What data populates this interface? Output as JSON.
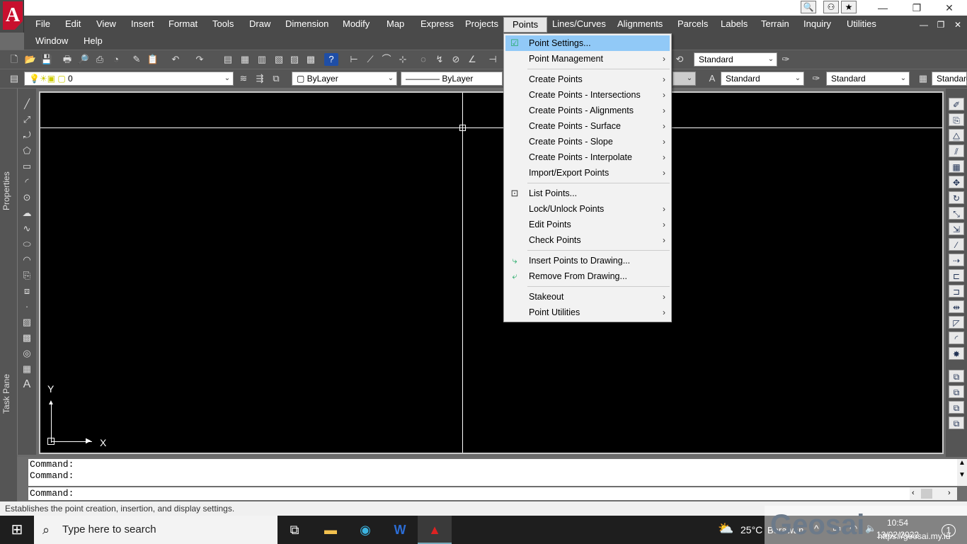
{
  "app": {
    "logo_letter": "A",
    "window_controls": [
      "—",
      "❐",
      "✕"
    ],
    "title_buttons": [
      "🔍",
      "⚇",
      "★"
    ]
  },
  "menubar": {
    "row1": [
      "File",
      "Edit",
      "View",
      "Insert",
      "Format",
      "Tools",
      "Draw",
      "Dimension",
      "Modify",
      "Map",
      "Express",
      "Projects",
      "Points",
      "Lines/Curves",
      "Alignments",
      "Parcels",
      "Labels",
      "Terrain",
      "Inquiry",
      "Utilities"
    ],
    "row2": [
      "Window",
      "Help"
    ],
    "active": "Points",
    "mdi_controls": [
      "—",
      "❐",
      "✕"
    ]
  },
  "toolbar1": {
    "style_combo": "Standard"
  },
  "toolbar2": {
    "layer_combo": "0",
    "color_combo": "ByLayer",
    "linetype_combo": "ByLayer",
    "textstyle_combo": "Standard",
    "dimstyle_combo": "Standard",
    "tablestyle_combo": "Standard"
  },
  "side_tabs": {
    "properties": "Properties",
    "task_pane": "Task Pane"
  },
  "canvas": {
    "ucs_x": "X",
    "ucs_y": "Y"
  },
  "command": {
    "history": [
      "Command:",
      "Command:"
    ],
    "prompt": "Command:"
  },
  "status": {
    "text": "Establishes the point creation, insertion, and display settings."
  },
  "points_menu": {
    "items": [
      {
        "label": "Point Settings...",
        "submenu": false,
        "icon": "point-settings-icon",
        "highlighted": true
      },
      {
        "label": "Point Management",
        "submenu": true
      },
      {
        "label": "Create Points",
        "submenu": true
      },
      {
        "label": "Create Points - Intersections",
        "submenu": true
      },
      {
        "label": "Create Points - Alignments",
        "submenu": true
      },
      {
        "label": "Create Points - Surface",
        "submenu": true
      },
      {
        "label": "Create Points - Slope",
        "submenu": true
      },
      {
        "label": "Create Points - Interpolate",
        "submenu": true
      },
      {
        "label": "Import/Export Points",
        "submenu": true
      },
      {
        "label": "List Points...",
        "submenu": false,
        "icon": "list-points-icon"
      },
      {
        "label": "Lock/Unlock Points",
        "submenu": true
      },
      {
        "label": "Edit Points",
        "submenu": true
      },
      {
        "label": "Check Points",
        "submenu": true
      },
      {
        "label": "Insert Points to Drawing...",
        "submenu": false,
        "icon": "insert-points-icon"
      },
      {
        "label": "Remove From Drawing...",
        "submenu": false,
        "icon": "remove-points-icon"
      },
      {
        "label": "Stakeout",
        "submenu": true
      },
      {
        "label": "Point Utilities",
        "submenu": true
      }
    ],
    "submenu_arrow": "›"
  },
  "taskbar": {
    "search_placeholder": "Type here to search",
    "weather_temp": "25°C",
    "weather_desc": "Berawan",
    "time": "10:54",
    "date": "13/02/2022",
    "url_fragment": "https://geosai.my.id"
  },
  "watermark": "Geosai"
}
